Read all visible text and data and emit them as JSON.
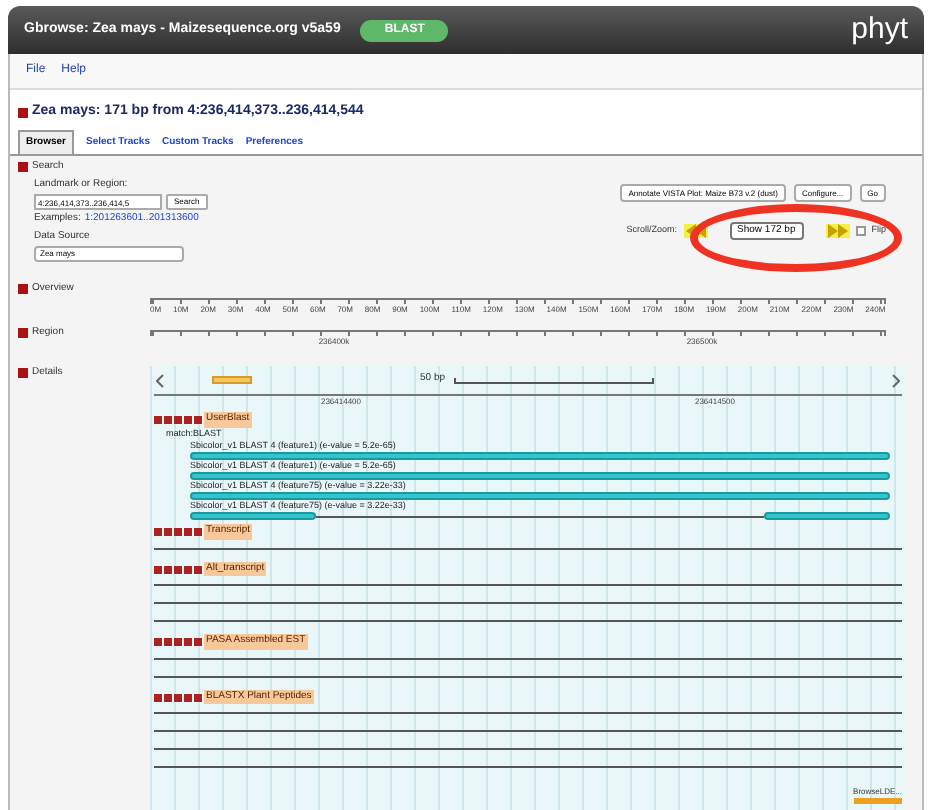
{
  "header": {
    "title": "Gbrowse: Zea mays - Maizesequence.org v5a59",
    "badge": "BLAST",
    "logo": "phyt"
  },
  "menu": [
    "File",
    "Help"
  ],
  "heading": "Zea mays: 171 bp from 4:236,414,373..236,414,544",
  "tabs": [
    {
      "label": "Browser",
      "selected": true
    },
    {
      "label": "Select Tracks",
      "selected": false
    },
    {
      "label": "Custom Tracks",
      "selected": false
    },
    {
      "label": "Preferences",
      "selected": false
    }
  ],
  "search": {
    "section": "Search",
    "landmark_label": "Landmark or Region:",
    "landmark_value": "4:236,414,373..236,414,5",
    "search_button": "Search",
    "examples_label": "Examples:",
    "example_link": "1:201263601..201313600",
    "data_source_label": "Data Source",
    "data_source_value": "Zea mays",
    "annotate_select": "Annotate VISTA Plot: Maize B73 v.2 (dust)",
    "configure_button": "Configure...",
    "go_button": "Go",
    "scroll_label": "Scroll/Zoom:",
    "zoom_select": "Show 172 bp",
    "flip_label": "Flip",
    "flip_checked": false
  },
  "annotation": {
    "kind": "ellipse",
    "color": "#ee3322"
  },
  "overview": {
    "label": "Overview",
    "ticks": [
      "0M",
      "10M",
      "20M",
      "30M",
      "40M",
      "50M",
      "60M",
      "70M",
      "80M",
      "90M",
      "100M",
      "110M",
      "120M",
      "130M",
      "140M",
      "150M",
      "160M",
      "170M",
      "180M",
      "190M",
      "200M",
      "210M",
      "220M",
      "230M",
      "240M"
    ]
  },
  "region": {
    "label": "Region",
    "ticks": [
      "236400k",
      "236500k"
    ]
  },
  "details": {
    "label": "Details",
    "scale": "50 bp",
    "ticks": [
      "236414400",
      "236414500"
    ],
    "tracks": [
      {
        "name": "UserBlast",
        "subtitle": "match:BLAST",
        "features": [
          {
            "kind": "full",
            "label": "Sbicolor_v1 BLAST 4 (feature1) (e-value = 5.2e-65)"
          },
          {
            "kind": "full",
            "label": "Sbicolor_v1 BLAST 4 (feature1) (e-value = 5.2e-65)"
          },
          {
            "kind": "full",
            "label": "Sbicolor_v1 BLAST 4 (feature75) (e-value = 3.22e-33)"
          },
          {
            "kind": "split",
            "label": "Sbicolor_v1 BLAST 4 (feature75) (e-value = 3.22e-33)"
          }
        ]
      },
      {
        "name": "Transcript",
        "features": [
          {
            "kind": "line"
          }
        ]
      },
      {
        "name": "Alt_transcript",
        "features": [
          {
            "kind": "line"
          },
          {
            "kind": "line"
          },
          {
            "kind": "line"
          }
        ]
      },
      {
        "name": "PASA Assembled EST",
        "features": [
          {
            "kind": "line"
          },
          {
            "kind": "line"
          }
        ]
      },
      {
        "name": "BLASTX Plant Peptides",
        "features": [
          {
            "kind": "line"
          },
          {
            "kind": "line"
          },
          {
            "kind": "line"
          },
          {
            "kind": "line"
          }
        ]
      }
    ],
    "footer": "BrowseLDE..."
  }
}
